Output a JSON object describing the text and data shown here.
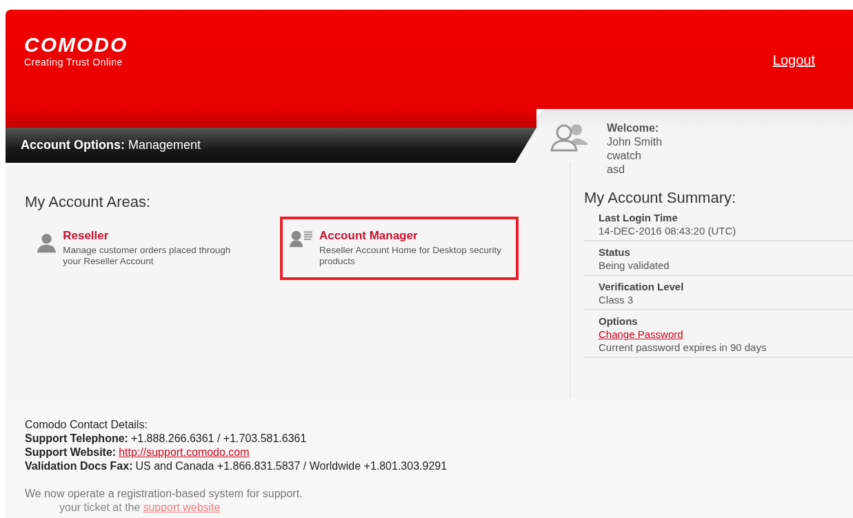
{
  "header": {
    "logo": "COMODO",
    "tagline": "Creating Trust Online",
    "logout": "Logout"
  },
  "options_bar": {
    "label": "Account Options:",
    "value": "Management"
  },
  "welcome": {
    "title": "Welcome:",
    "lines": [
      "John Smith",
      "cwatch",
      "asd"
    ]
  },
  "areas": {
    "title": "My Account Areas:",
    "items": [
      {
        "kind": "person",
        "title": "Reseller",
        "description": "Manage customer orders placed through your Reseller Account",
        "selected": false
      },
      {
        "kind": "card",
        "title": "Account Manager",
        "description": "Reseller Account Home for Desktop security products",
        "selected": true
      }
    ]
  },
  "summary": {
    "title": "My Account Summary:",
    "rows": [
      {
        "label": "Last Login Time",
        "value": "14-DEC-2016 08:43:20 (UTC)"
      },
      {
        "label": "Status",
        "value": "Being validated"
      },
      {
        "label": "Verification Level",
        "value": "Class 3"
      },
      {
        "label": "Options",
        "link": "Change Password",
        "value": "Current password expires in 90 days"
      }
    ]
  },
  "contact": {
    "title": "Comodo Contact Details:",
    "lines": [
      {
        "label": "Support Telephone:",
        "text": "+1.888.266.6361 / +1.703.581.6361"
      },
      {
        "label": "Support Website:",
        "link": "http://support.comodo.com"
      },
      {
        "label": "Validation Docs Fax:",
        "text": "US and Canada +1.866.831.5837 / Worldwide +1.801.303.9291"
      }
    ],
    "notice": "We now operate a registration-based system for support.",
    "notice_tail": "your ticket at the",
    "notice_link": "support website"
  }
}
